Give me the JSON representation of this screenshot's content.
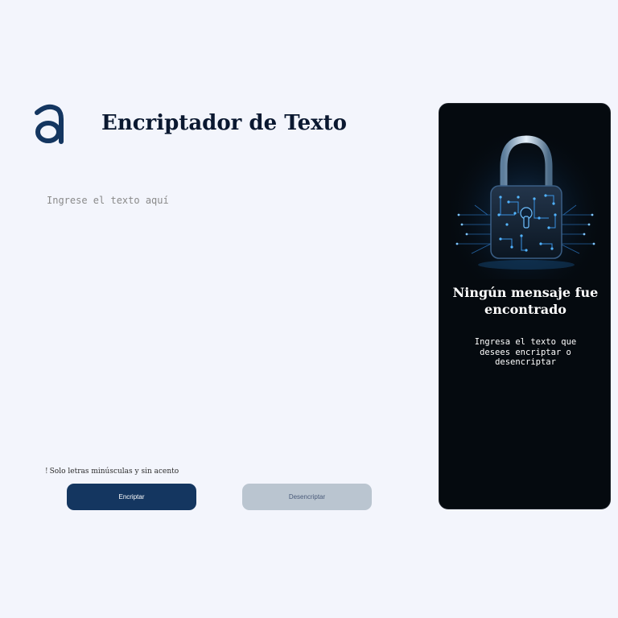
{
  "header": {
    "logo_icon": "alura-a-logo",
    "title": "Encriptador de Texto"
  },
  "input": {
    "placeholder": "Ingrese el texto aquí",
    "value": ""
  },
  "hint": {
    "icon": "exclamation-icon",
    "text": "Solo letras minúsculas y sin acento"
  },
  "buttons": {
    "encrypt_label": "Encriptar",
    "decrypt_label": "Desencriptar"
  },
  "result_panel": {
    "image_icon": "padlock-circuit-image",
    "title": "Ningún mensaje fue encontrado",
    "message": "Ingresa el texto que desees encriptar o desencriptar"
  },
  "colors": {
    "background": "#f3f5fc",
    "primary": "#143660",
    "secondary": "#bac5d0",
    "panel": "#050a0f"
  }
}
